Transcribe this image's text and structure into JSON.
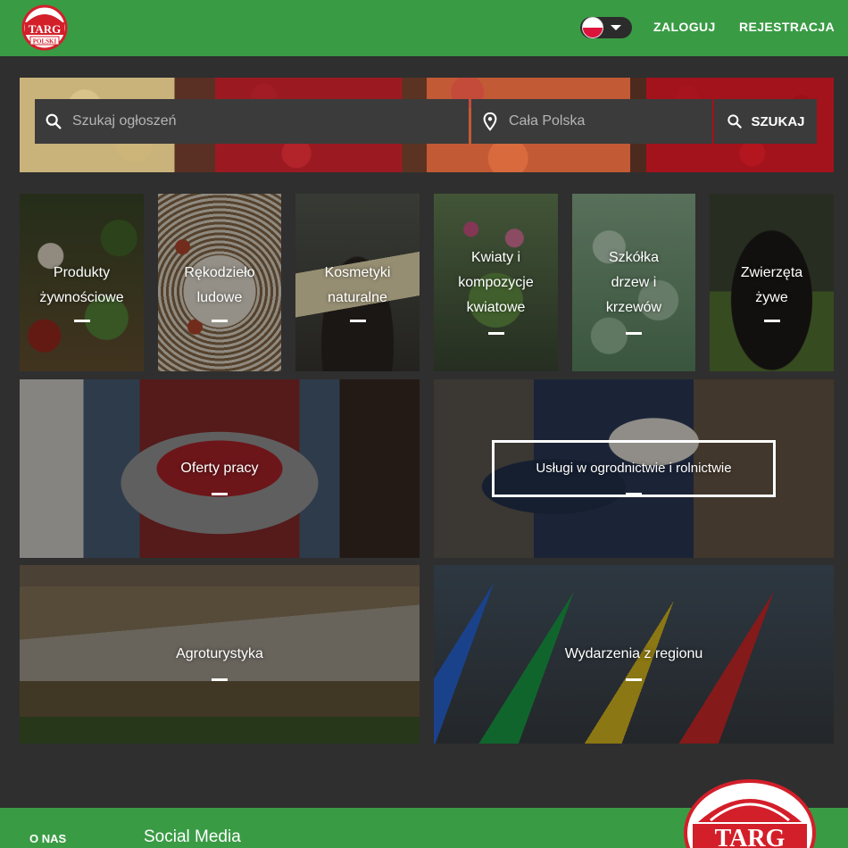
{
  "header": {
    "logo_text_main": "TARG",
    "logo_text_sub": "POLSKI",
    "language_flag": "pl-flag",
    "login_label": "ZALOGUJ",
    "register_label": "REJESTRACJA",
    "bg_color": "#3a9b45"
  },
  "search": {
    "query_placeholder": "Szukaj ogłoszeń",
    "location_value": "Cała Polska",
    "button_label": "SZUKAJ"
  },
  "categories": [
    {
      "label_lines": [
        "Produkty",
        "żywnościowe"
      ]
    },
    {
      "label_lines": [
        "Rękodzieło",
        "ludowe"
      ]
    },
    {
      "label_lines": [
        "Kosmetyki",
        "naturalne"
      ]
    },
    {
      "label_lines": [
        "Kwiaty i",
        "kompozycje",
        "kwiatowe"
      ]
    },
    {
      "label_lines": [
        "Szkółka",
        "drzew i",
        "krzewów"
      ]
    },
    {
      "label_lines": [
        "Zwierzęta",
        "żywe"
      ]
    },
    {
      "label_lines": [
        "Oferty pracy"
      ]
    },
    {
      "label_lines": [
        "Usługi w ogrodnictwie i rolnictwie"
      ]
    },
    {
      "label_lines": [
        "Agroturystyka"
      ]
    },
    {
      "label_lines": [
        "Wydarzenia z regionu"
      ]
    }
  ],
  "footer": {
    "about_label": "O NAS",
    "social_heading": "Social Media",
    "logo_text": "TARG"
  }
}
